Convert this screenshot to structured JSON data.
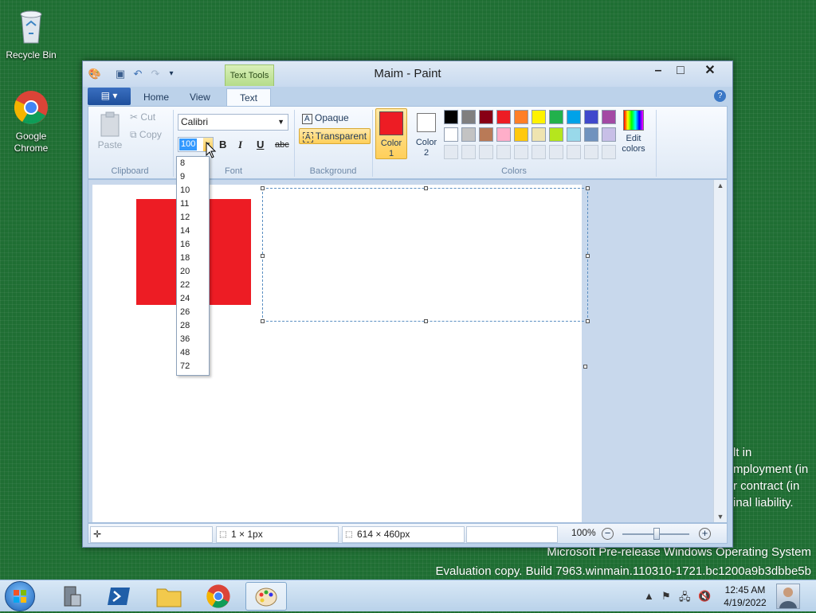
{
  "desktop": {
    "icons": [
      {
        "label": "Recycle Bin",
        "icon": "recycle-bin-icon"
      },
      {
        "label": "Google Chrome",
        "icon": "chrome-icon"
      }
    ],
    "watermark": {
      "line1": "Microsoft Pre-release Windows Operating System",
      "line2": "Evaluation copy. Build 7963.winmain.110310-1721.bc1200a9b3dbbe5b",
      "partial_text": [
        "lt in",
        "mployment (in",
        "r contract (in",
        "inal liability."
      ]
    }
  },
  "window": {
    "title": "Maim - Paint",
    "contextual_tab": "Text Tools",
    "tabs": [
      "Home",
      "View",
      "Text"
    ],
    "active_tab": "Text"
  },
  "ribbon": {
    "clipboard": {
      "paste": "Paste",
      "cut": "Cut",
      "copy": "Copy",
      "label": "Clipboard"
    },
    "font": {
      "family": "Calibri",
      "size": "100",
      "bold": "B",
      "italic": "I",
      "underline": "U",
      "strike": "abc",
      "label": "Font"
    },
    "background": {
      "opaque": "Opaque",
      "transparent": "Transparent",
      "label": "Background",
      "selected": "Transparent"
    },
    "colors": {
      "color1_label": "Color 1",
      "color2_label": "Color 2",
      "color1": "#ed1c24",
      "color2": "#ffffff",
      "edit_label": "Edit colors",
      "label": "Colors",
      "palette_row1": [
        "#000000",
        "#7f7f7f",
        "#880015",
        "#ed1c24",
        "#ff7f27",
        "#fff200",
        "#22b14c",
        "#00a2e8",
        "#3f48cc",
        "#a349a4"
      ],
      "palette_row2": [
        "#ffffff",
        "#c3c3c3",
        "#b97a57",
        "#ffaec9",
        "#ffc90e",
        "#efe4b0",
        "#b5e61d",
        "#99d9ea",
        "#7092be",
        "#c8bfe7"
      ]
    }
  },
  "font_size_options": [
    "8",
    "9",
    "10",
    "11",
    "12",
    "14",
    "16",
    "18",
    "20",
    "22",
    "24",
    "26",
    "28",
    "36",
    "48",
    "72"
  ],
  "statusbar": {
    "selection_size": "1 × 1px",
    "image_size": "614 × 460px",
    "zoom": "100%"
  },
  "taskbar": {
    "time": "12:45 AM",
    "date": "4/19/2022",
    "pinned": [
      "start-orb",
      "server-manager",
      "powershell",
      "explorer",
      "chrome",
      "paint"
    ]
  }
}
